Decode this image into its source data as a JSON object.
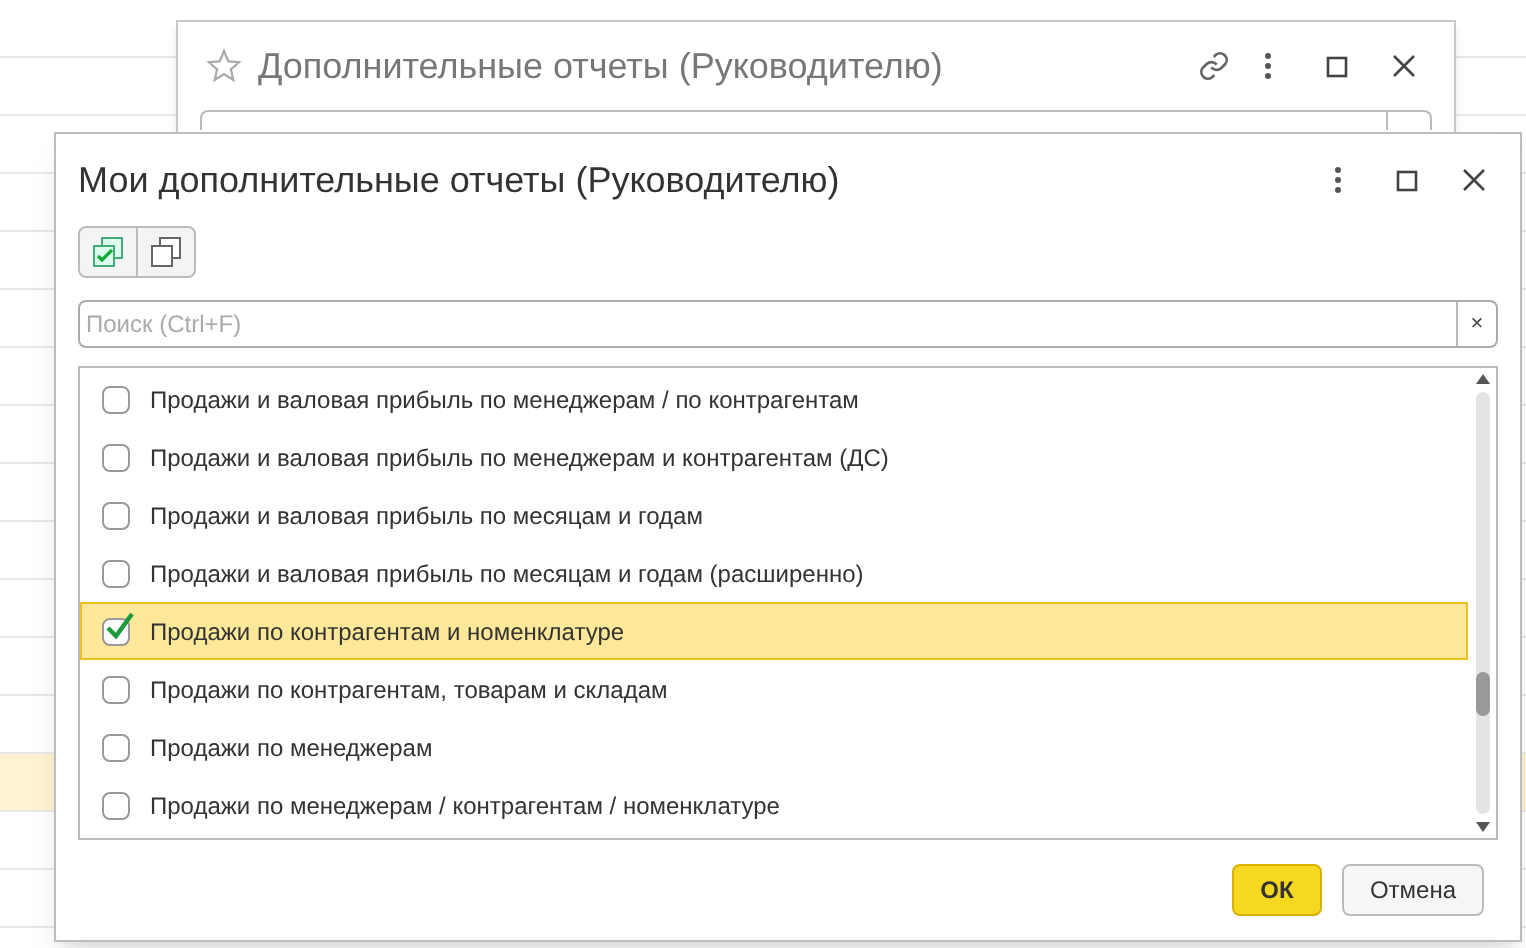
{
  "back_window": {
    "title": "Дополнительные отчеты (Руководителю)"
  },
  "dialog": {
    "title": "Мои дополнительные отчеты (Руководителю)",
    "search": {
      "placeholder": "Поиск (Ctrl+F)"
    },
    "clear": "×",
    "items": [
      {
        "label": "Продажи и валовая прибыль по менеджерам / по контрагентам",
        "checked": false,
        "selected": false
      },
      {
        "label": "Продажи и валовая прибыль по менеджерам и контрагентам (ДС)",
        "checked": false,
        "selected": false
      },
      {
        "label": "Продажи и валовая прибыль по месяцам и годам",
        "checked": false,
        "selected": false
      },
      {
        "label": "Продажи и валовая прибыль по месяцам и годам (расширенно)",
        "checked": false,
        "selected": false
      },
      {
        "label": "Продажи по контрагентам и номенклатуре",
        "checked": true,
        "selected": true
      },
      {
        "label": "Продажи по контрагентам, товарам и складам",
        "checked": false,
        "selected": false
      },
      {
        "label": "Продажи по менеджерам",
        "checked": false,
        "selected": false
      },
      {
        "label": "Продажи по менеджерам / контрагентам / номенклатуре",
        "checked": false,
        "selected": false
      }
    ],
    "buttons": [
      {
        "label": "ОК",
        "kind": "primary"
      },
      {
        "label": "Отмена",
        "kind": "secondary"
      }
    ]
  }
}
